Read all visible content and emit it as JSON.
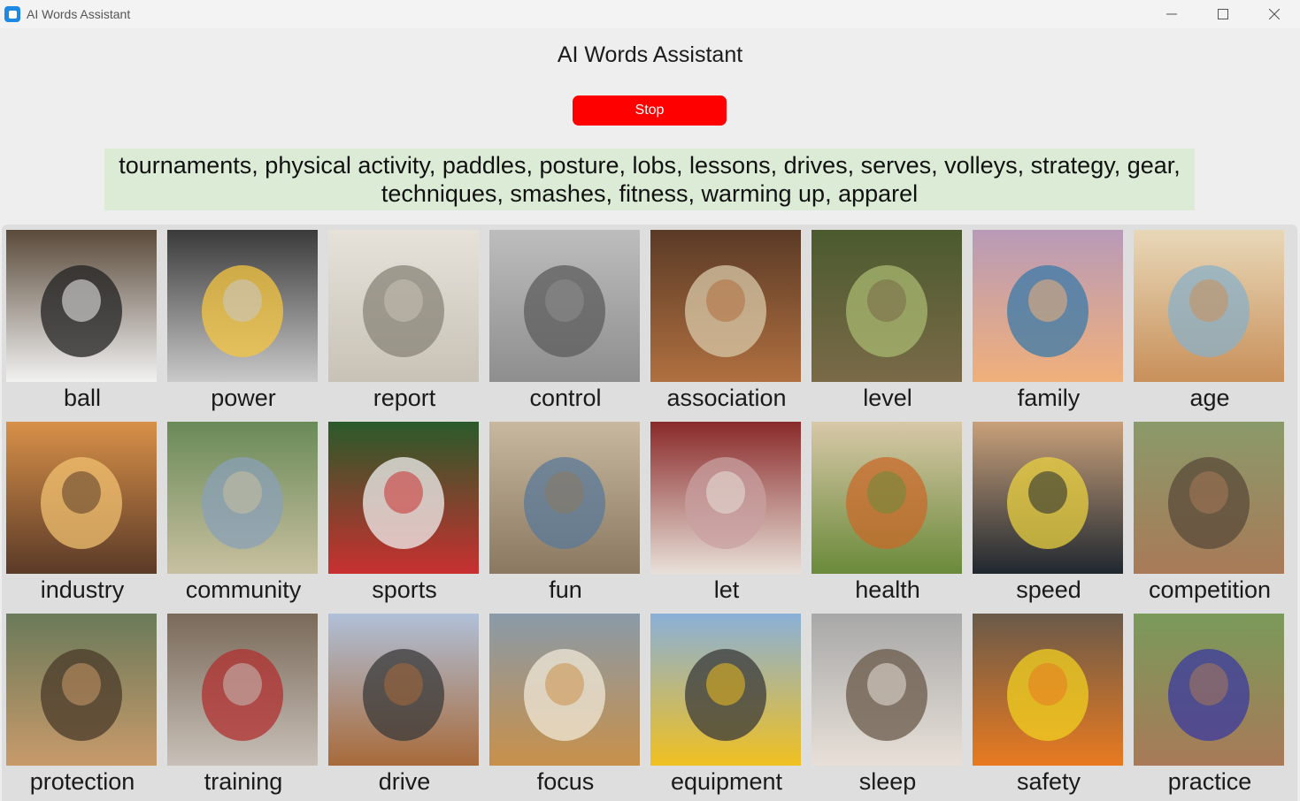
{
  "window": {
    "title": "AI Words Assistant"
  },
  "header": {
    "title": "AI Words Assistant",
    "stop_label": "Stop"
  },
  "words": "tournaments, physical activity, paddles, posture, lobs, lessons, drives, serves, volleys, strategy, gear, techniques, smashes, fitness, warming up, apparel",
  "colors": {
    "stop_button": "#ff0000",
    "words_background": "#dcebd6"
  },
  "cards": [
    {
      "label": "ball",
      "icon": "soccer-ball-image"
    },
    {
      "label": "power",
      "icon": "light-bulb-image"
    },
    {
      "label": "report",
      "icon": "document-sketch-image"
    },
    {
      "label": "control",
      "icon": "game-controller-image"
    },
    {
      "label": "association",
      "icon": "meeting-table-image"
    },
    {
      "label": "level",
      "icon": "forest-house-image"
    },
    {
      "label": "family",
      "icon": "family-emblem-image"
    },
    {
      "label": "age",
      "icon": "elderly-woman-image"
    },
    {
      "label": "industry",
      "icon": "factory-image"
    },
    {
      "label": "community",
      "icon": "town-island-image"
    },
    {
      "label": "sports",
      "icon": "soccer-players-image"
    },
    {
      "label": "fun",
      "icon": "women-walking-beach-image"
    },
    {
      "label": "let",
      "icon": "tunnel-image"
    },
    {
      "label": "health",
      "icon": "fruits-vegetables-image"
    },
    {
      "label": "speed",
      "icon": "sports-car-image"
    },
    {
      "label": "competition",
      "icon": "horse-rider-image"
    },
    {
      "label": "protection",
      "icon": "dogs-in-forest-image"
    },
    {
      "label": "training",
      "icon": "man-running-image"
    },
    {
      "label": "drive",
      "icon": "classic-car-image"
    },
    {
      "label": "focus",
      "icon": "dog-portrait-image"
    },
    {
      "label": "equipment",
      "icon": "excavator-image"
    },
    {
      "label": "sleep",
      "icon": "sleeping-person-image"
    },
    {
      "label": "safety",
      "icon": "construction-worker-image"
    },
    {
      "label": "practice",
      "icon": "football-players-image"
    }
  ]
}
